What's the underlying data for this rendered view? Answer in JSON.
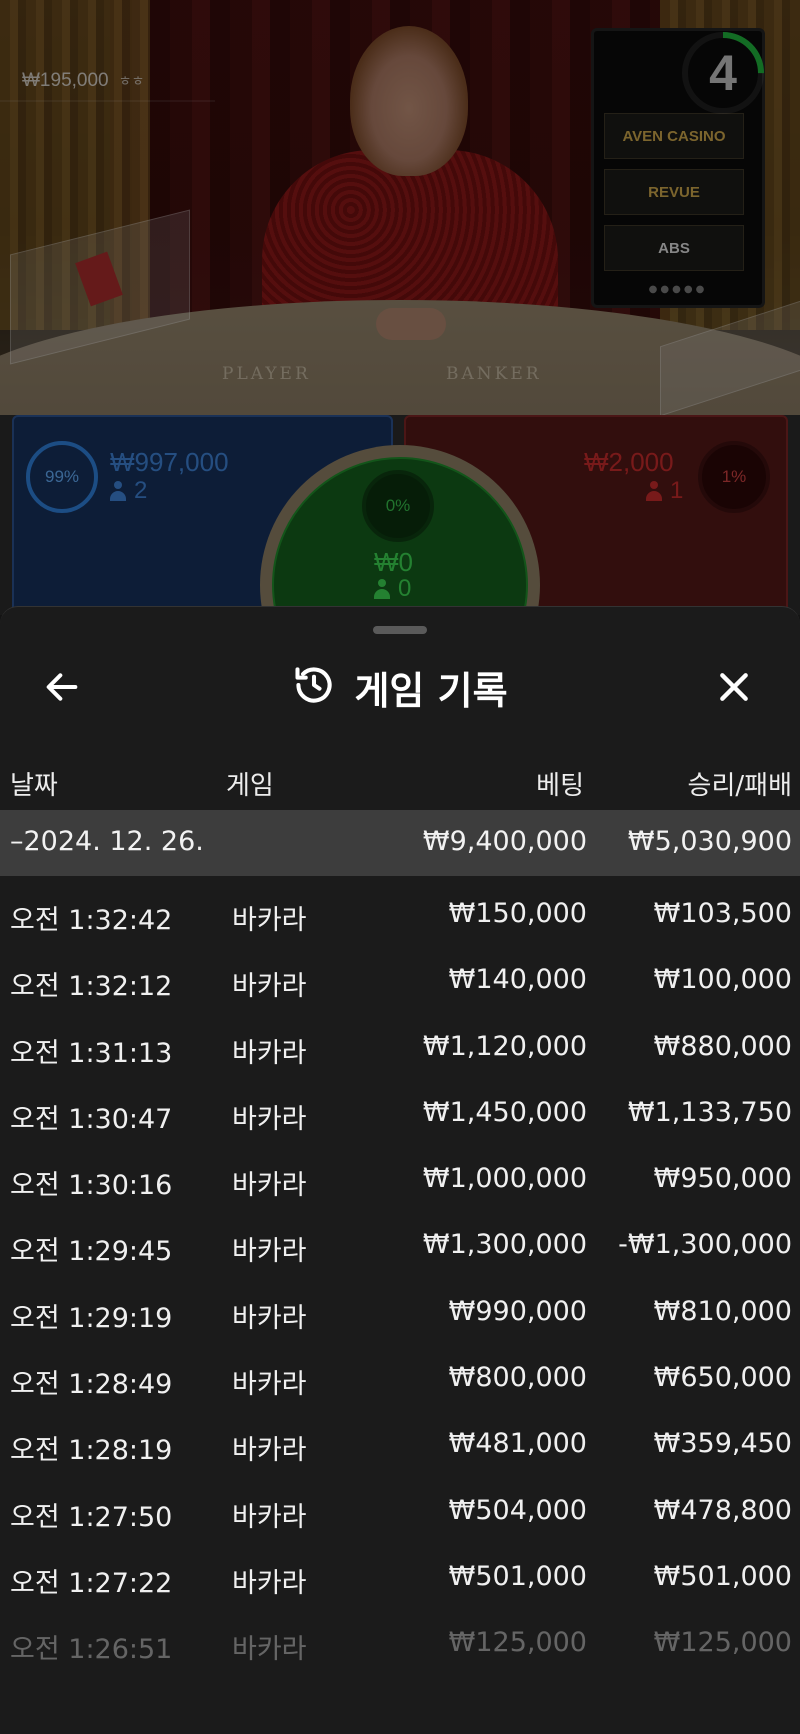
{
  "live": {
    "balance": "₩195,000",
    "balance_sub": "ㅎㅎ",
    "countdown": "4",
    "countdown_progress": 0.25,
    "table_labels": {
      "player": "PLAYER",
      "banker": "BANKER"
    },
    "screen_logos": [
      "AVEN CASINO",
      "REVUE",
      "ABS"
    ]
  },
  "bets": {
    "player": {
      "percent": "99%",
      "amount": "₩997,000",
      "count": "2"
    },
    "tie": {
      "percent": "0%",
      "amount": "₩0",
      "count": "0"
    },
    "banker": {
      "percent": "1%",
      "amount": "₩2,000",
      "count": "1"
    }
  },
  "sheet": {
    "title": "게임 기록",
    "columns": {
      "date": "날짜",
      "game": "게임",
      "bet": "베팅",
      "win_loss": "승리/패배"
    },
    "summary": {
      "date": "–2024. 12. 26.",
      "bet": "₩9,400,000",
      "win_loss": "₩5,030,900"
    },
    "rows": [
      {
        "time": "오전 1:32:42",
        "game": "바카라",
        "bet": "₩150,000",
        "win_loss": "₩103,500"
      },
      {
        "time": "오전 1:32:12",
        "game": "바카라",
        "bet": "₩140,000",
        "win_loss": "₩100,000"
      },
      {
        "time": "오전 1:31:13",
        "game": "바카라",
        "bet": "₩1,120,000",
        "win_loss": "₩880,000"
      },
      {
        "time": "오전 1:30:47",
        "game": "바카라",
        "bet": "₩1,450,000",
        "win_loss": "₩1,133,750"
      },
      {
        "time": "오전 1:30:16",
        "game": "바카라",
        "bet": "₩1,000,000",
        "win_loss": "₩950,000"
      },
      {
        "time": "오전 1:29:45",
        "game": "바카라",
        "bet": "₩1,300,000",
        "win_loss": "-₩1,300,000"
      },
      {
        "time": "오전 1:29:19",
        "game": "바카라",
        "bet": "₩990,000",
        "win_loss": "₩810,000"
      },
      {
        "time": "오전 1:28:49",
        "game": "바카라",
        "bet": "₩800,000",
        "win_loss": "₩650,000"
      },
      {
        "time": "오전 1:28:19",
        "game": "바카라",
        "bet": "₩481,000",
        "win_loss": "₩359,450"
      },
      {
        "time": "오전 1:27:50",
        "game": "바카라",
        "bet": "₩504,000",
        "win_loss": "₩478,800"
      },
      {
        "time": "오전 1:27:22",
        "game": "바카라",
        "bet": "₩501,000",
        "win_loss": "₩501,000"
      },
      {
        "time": "오전 1:26:51",
        "game": "바카라",
        "bet": "₩125,000",
        "win_loss": "₩125,000"
      }
    ]
  },
  "icons": {
    "back": "arrow-left-icon",
    "history": "history-icon",
    "close": "close-icon",
    "person": "person-icon"
  },
  "colors": {
    "player": "#2e7cd6",
    "banker": "#c22a2a",
    "tie": "#3bd04f",
    "sheet_bg": "#1b1b1b",
    "summary_bg": "#3d3d3d"
  }
}
